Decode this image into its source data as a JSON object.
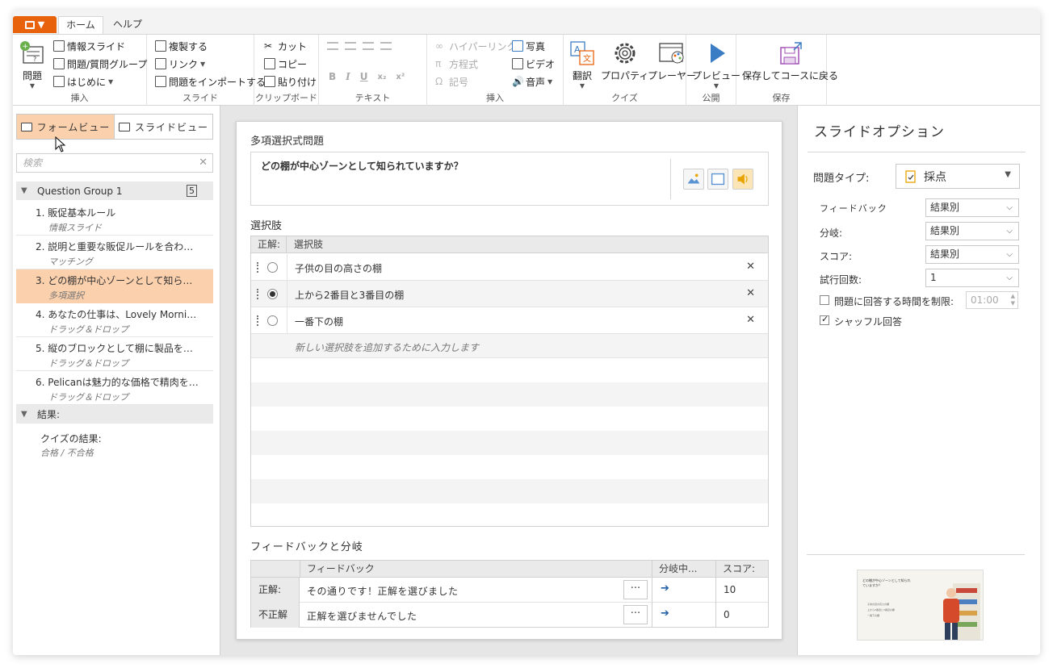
{
  "tabs": {
    "home": "ホーム",
    "help": "ヘルプ"
  },
  "ribbon": {
    "insert": {
      "question": "問題",
      "info_slide": "情報スライド",
      "question_group": "問題/質問グループ",
      "intro": "はじめに",
      "label": "挿入"
    },
    "slide": {
      "duplicate": "複製する",
      "link": "リンク",
      "import": "問題をインポートする",
      "label": "スライド"
    },
    "clipboard": {
      "cut": "カット",
      "copy": "コピー",
      "paste": "貼り付け",
      "label": "クリップボード"
    },
    "text": {
      "bold": "B",
      "italic": "I",
      "underline": "U",
      "sub": "x₂",
      "sup": "x²",
      "label": "テキスト"
    },
    "insert2": {
      "hyperlink": "ハイパーリンク",
      "equation": "方程式",
      "symbol": "記号",
      "photo": "写真",
      "video": "ビデオ",
      "audio": "音声",
      "label": "挿入"
    },
    "quiz": {
      "translate": "翻訳",
      "properties": "プロパティ",
      "player": "プレーヤー",
      "label": "クイズ"
    },
    "publish": {
      "preview": "プレビュー",
      "label": "公開"
    },
    "save": {
      "save_return": "保存してコースに戻る",
      "label": "保存"
    }
  },
  "left": {
    "form_view": "フォームビュー",
    "slide_view": "スライドビュー",
    "search_placeholder": "検索",
    "group": {
      "label": "Question Group 1",
      "count": "5"
    },
    "items": [
      {
        "num": "1.",
        "title": "販促基本ルール",
        "type": "情報スライド"
      },
      {
        "num": "2.",
        "title": "説明と重要な販促ルールを合わ…",
        "type": "マッチング"
      },
      {
        "num": "3.",
        "title": "どの棚が中心ゾーンとして知ら…",
        "type": "多項選択"
      },
      {
        "num": "4.",
        "title": "あなたの仕事は、Lovely Morni…",
        "type": "ドラッグ＆ドロップ"
      },
      {
        "num": "5.",
        "title": "縦のブロックとして棚に製品を…",
        "type": "ドラッグ＆ドロップ"
      },
      {
        "num": "6.",
        "title": "Pelicanは魅力的な価格で精肉を…",
        "type": "ドラッグ＆ドロップ"
      }
    ],
    "results": {
      "label": "結果:",
      "title": "クイズの結果:",
      "sub": "合格 / 不合格"
    }
  },
  "center": {
    "question_type_title": "多項選択式問題",
    "question_text": "どの棚が中心ゾーンとして知られていますか？",
    "choices_title": "選択肢",
    "choices_head": {
      "correct": "正解:",
      "choice": "選択肢"
    },
    "choices": [
      {
        "text": "子供の目の高さの棚",
        "correct": false
      },
      {
        "text": "上から2番目と3番目の棚",
        "correct": true
      },
      {
        "text": "一番下の棚",
        "correct": false
      }
    ],
    "new_choice_placeholder": "新しい選択肢を追加するために入力します",
    "feedback_title": "フィードバックと分岐",
    "feedback_head": {
      "feedback": "フィードバック",
      "branch": "分岐中...",
      "score": "スコア:"
    },
    "feedback_rows": [
      {
        "label": "正解:",
        "text": "その通りです！正解を選びました",
        "more": "···",
        "branch": "➔",
        "score": "10"
      },
      {
        "label": "不正解",
        "text": "正解を選びませんでした",
        "more": "···",
        "branch": "➔",
        "score": "0"
      }
    ]
  },
  "right": {
    "title": "スライドオプション",
    "question_type_label": "問題タイプ:",
    "question_type_value": "採点",
    "options": [
      {
        "label": "フィードバック",
        "value": "結果別"
      },
      {
        "label": "分岐:",
        "value": "結果別"
      },
      {
        "label": "スコア:",
        "value": "結果別"
      },
      {
        "label": "試行回数:",
        "value": "1"
      }
    ],
    "time_limit_label": "問題に回答する時間を制限:",
    "time_limit_value": "01:00",
    "shuffle_label": "シャッフル回答",
    "thumb": {
      "title": "どの棚が中心ゾーンとして知られていますか？",
      "c1": "子供の目の高さの棚",
      "c2": "上から2番目と3番目の棚",
      "c3": "一番下の棚"
    }
  },
  "colors": {
    "accent": "#e8620c",
    "selection": "#fbd0ad",
    "link_blue": "#1f5fa8"
  }
}
